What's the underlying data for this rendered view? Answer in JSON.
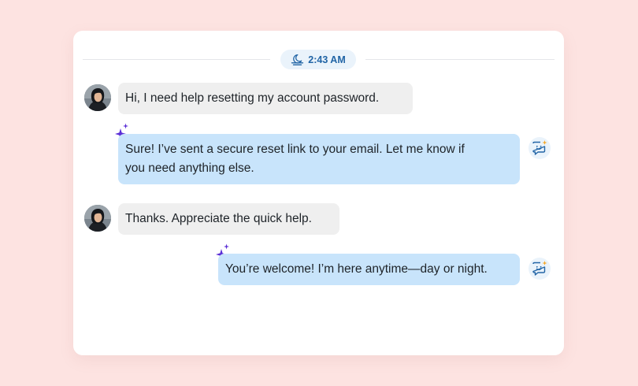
{
  "timestamp": {
    "icon": "moon-horizon-icon",
    "time": "2:43 AM"
  },
  "messages": [
    {
      "sender": "user",
      "text": "Hi, I need help resetting my account password."
    },
    {
      "sender": "bot",
      "line1": "Sure! I’ve sent a secure reset link to your email. Let me know if",
      "line2": "you need anything else."
    },
    {
      "sender": "user",
      "text": "Thanks. Appreciate the quick help."
    },
    {
      "sender": "bot",
      "text": "You’re welcome! I’m here anytime—day or night."
    }
  ],
  "colors": {
    "page_background": "#fde3e1",
    "card_background": "#ffffff",
    "user_bubble": "#efefef",
    "bot_bubble": "#c8e4fb",
    "accent_blue": "#2265a6",
    "sparkle_purple": "#5b2fd6",
    "badge_star_orange": "#f5a623"
  }
}
